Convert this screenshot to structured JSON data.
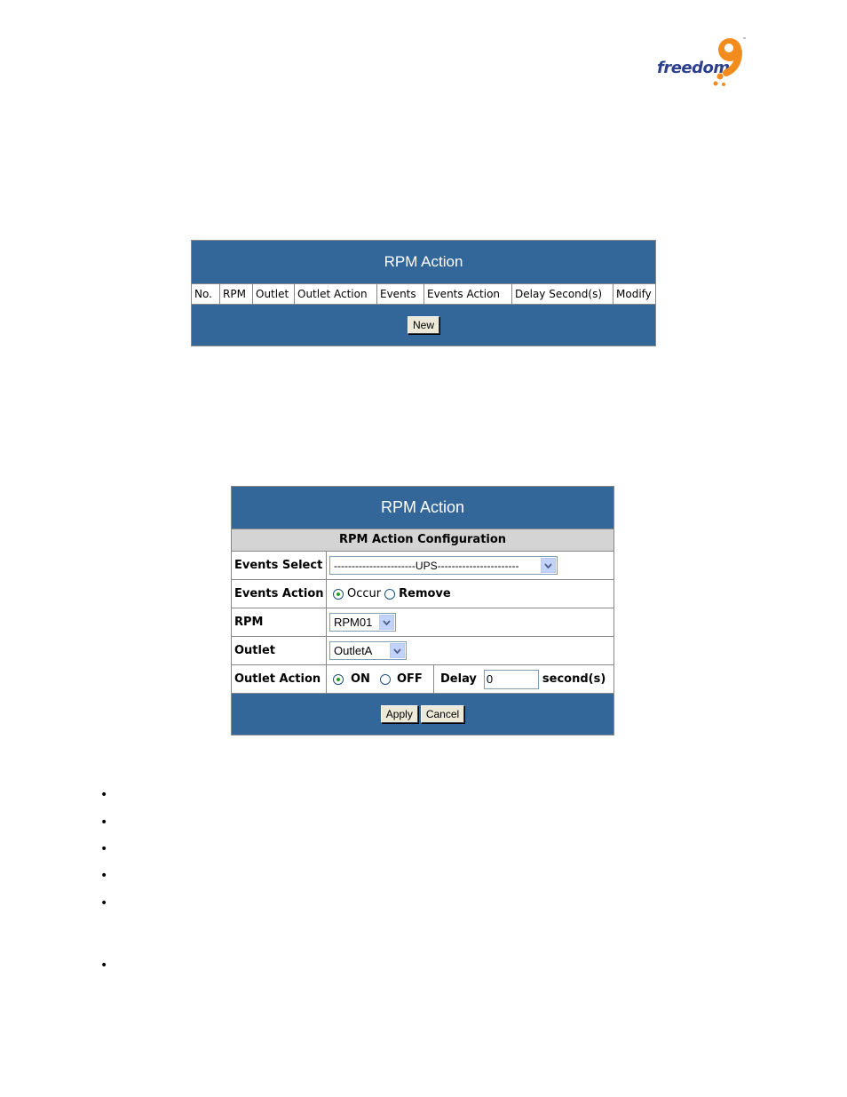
{
  "logo": {
    "text": "freedom",
    "mark": "9",
    "tm": "™"
  },
  "rpm_list": {
    "title": "RPM Action",
    "columns": [
      "No.",
      "RPM",
      "Outlet",
      "Outlet Action",
      "Events",
      "Events Action",
      "Delay Second(s)",
      "Modify"
    ],
    "new_button": "New"
  },
  "rpm_config": {
    "title": "RPM Action",
    "section": "RPM Action Configuration",
    "events_select": {
      "label": "Events Select",
      "value": "-----------------------UPS-----------------------"
    },
    "events_action": {
      "label": "Events Action",
      "option1": "Occur",
      "option2": "Remove",
      "selected": "Occur"
    },
    "rpm": {
      "label": "RPM",
      "value": "RPM01"
    },
    "outlet": {
      "label": "Outlet",
      "value": "OutletA"
    },
    "outlet_action": {
      "label": "Outlet Action",
      "on": "ON",
      "off": "OFF",
      "selected": "ON",
      "delay_label": "Delay",
      "delay_value": "0",
      "unit": "second(s)"
    },
    "apply_button": "Apply",
    "cancel_button": "Cancel"
  },
  "bullet_glyph": "•"
}
